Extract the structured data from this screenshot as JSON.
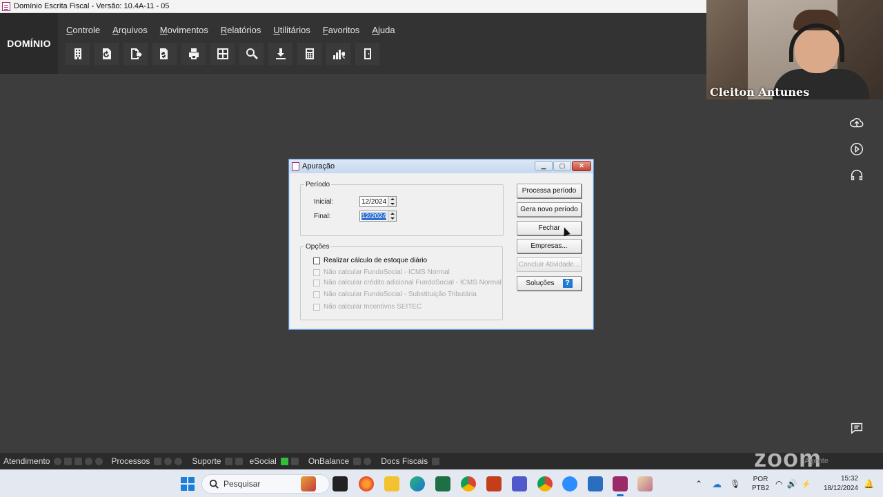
{
  "window": {
    "title": "Domínio Escrita Fiscal  - Versão: 10.4A-11 - 05"
  },
  "brand": "DOMÍNIO",
  "menu": [
    "Controle",
    "Arquivos",
    "Movimentos",
    "Relatórios",
    "Utilitários",
    "Favoritos",
    "Ajuda"
  ],
  "toolbar_icons": [
    "building-icon",
    "document-refresh-icon",
    "document-export-icon",
    "document-money-icon",
    "printer-icon",
    "calculator-grid-icon",
    "search-icon",
    "download-icon",
    "calculator-icon",
    "chart-search-icon",
    "door-icon"
  ],
  "webcam": {
    "name": "Cleiton Antunes"
  },
  "dialog": {
    "title": "Apuração",
    "periodo": {
      "legend": "Período",
      "inicial_label": "Inicial:",
      "inicial_value": "12/2024",
      "final_label": "Final:",
      "final_value": "12/2024"
    },
    "opcoes": {
      "legend": "Opções",
      "items": [
        {
          "label": "Realizar cálculo de estoque diário",
          "enabled": true
        },
        {
          "label": "Não calcular FundoSocial - ICMS Normal",
          "enabled": false
        },
        {
          "label": "Não calcular crédito adicional FundoSocial - ICMS Normal",
          "enabled": false
        },
        {
          "label": "Não calcular FundoSocial - Substituição Tributária",
          "enabled": false
        },
        {
          "label": "Não calcular Incentivos SEITEC",
          "enabled": false
        }
      ]
    },
    "buttons": {
      "processa": "Processa período",
      "gera": "Gera novo período",
      "fechar": "Fechar",
      "empresas": "Empresas...",
      "concluir": "Concluir Atividade...",
      "solucoes": "Soluções",
      "help_badge": "?"
    }
  },
  "statusbar": {
    "atendimento": "Atendimento",
    "processos": "Processos",
    "suporte": "Suporte",
    "esocial": "eSocial",
    "onbalance": "OnBalance",
    "docs": "Docs Fiscais",
    "zoom": "zoom",
    "agente": "Agente"
  },
  "taskbar": {
    "search_placeholder": "Pesquisar",
    "lang1": "POR",
    "lang2": "PTB2",
    "time": "15:32",
    "date": "18/12/2024"
  },
  "colors": {
    "accent": "#1f7ad0",
    "brand_pink": "#9a2a6a",
    "taskbar": "#e4e9f1"
  }
}
